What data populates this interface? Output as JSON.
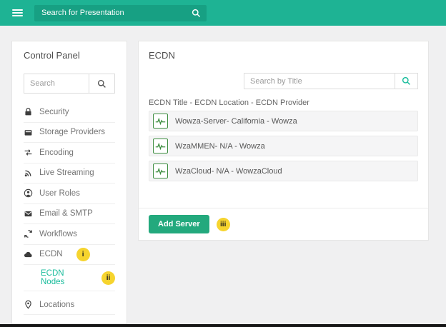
{
  "header": {
    "search_placeholder": "Search for Presentation"
  },
  "sidebar": {
    "title": "Control Panel",
    "search_placeholder": "Search",
    "items": [
      {
        "label": "Security",
        "icon": "lock-icon"
      },
      {
        "label": "Storage Providers",
        "icon": "storage-icon"
      },
      {
        "label": "Encoding",
        "icon": "transfer-arrows-icon"
      },
      {
        "label": "Live Streaming",
        "icon": "broadcast-icon"
      },
      {
        "label": "User Roles",
        "icon": "user-icon"
      },
      {
        "label": "Email & SMTP",
        "icon": "envelope-icon"
      },
      {
        "label": "Workflows",
        "icon": "workflow-arrows-icon"
      },
      {
        "label": "ECDN",
        "icon": "cloud-icon",
        "badge": "i"
      },
      {
        "label": "ECDN Nodes",
        "badge": "ii",
        "active": true
      },
      {
        "label": "Locations",
        "icon": "map-pin-icon"
      }
    ]
  },
  "main": {
    "title": "ECDN",
    "search_placeholder": "Search by Title",
    "list_header": "ECDN Title - ECDN Location - ECDN Provider",
    "servers": [
      {
        "title": "Wowza-Server- California - Wowza"
      },
      {
        "title": "WzaMMEN- N/A - Wowza"
      },
      {
        "title": "WzaCloud- N/A - WowzaCloud"
      }
    ],
    "add_button_label": "Add Server",
    "add_badge": "iii"
  },
  "colors": {
    "header_teal": "#1eb394",
    "header_search": "#17a083",
    "accent_teal": "#1abc9c",
    "button_green": "#23a97d",
    "badge_yellow": "#f6d42e",
    "icon_green": "#3e8e41",
    "row_bg": "#f5f5f6",
    "page_bg": "#f0f0f1",
    "card_border": "#e5e5e5",
    "text_gray": "#757575"
  }
}
